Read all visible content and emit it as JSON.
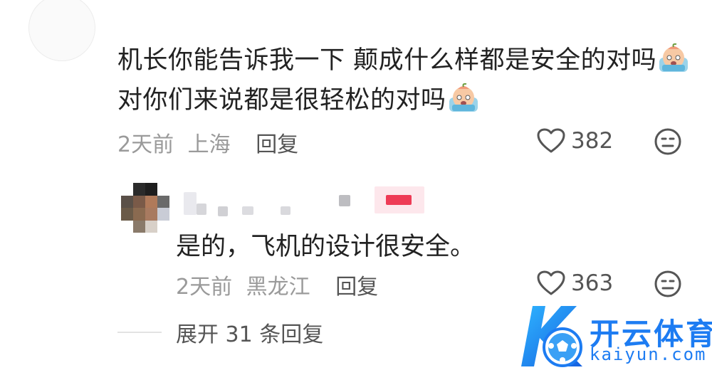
{
  "comment": {
    "line1": "机长你能告诉我一下 颠成什么样都是安全的对吗",
    "line2": "对你们来说都是很轻松的对吗",
    "emoji_icon": "crying-face-emoji",
    "time": "2天前",
    "location": "上海",
    "reply_label": "回复",
    "likes": "382"
  },
  "reply": {
    "text": "是的，飞机的设计很安全。",
    "time": "2天前",
    "location": "黑龙江",
    "reply_label": "回复",
    "likes": "363"
  },
  "expand_label": "展开 31 条回复",
  "watermark": {
    "brand": "开云体育",
    "domain": "kaiyun.com",
    "color": "#1d7cf2"
  }
}
